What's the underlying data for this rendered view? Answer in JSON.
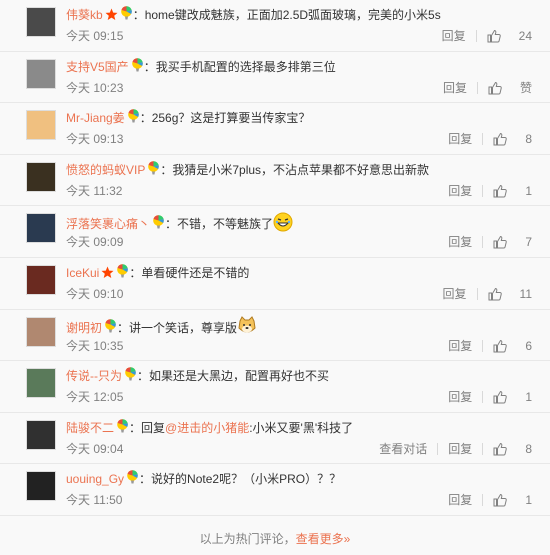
{
  "comments": [
    {
      "user": "伟葵kb",
      "text": "：home键改成魅族，正面加2.5D弧面玻璃，完美的小米5s",
      "time": "今天 09:15",
      "reply": "回复",
      "likes": "24",
      "avatar_color": "#4a4a4a"
    },
    {
      "user": "支持V5国产",
      "text": "：我买手机配置的选择最多排第三位",
      "time": "今天 10:23",
      "reply": "回复",
      "likes": "赞",
      "avatar_color": "#8a8a8a"
    },
    {
      "user": "Mr-Jiang姜",
      "text": "：256g？这是打算要当传家宝？",
      "time": "今天 09:13",
      "reply": "回复",
      "likes": "8",
      "avatar_color": "#f0c080"
    },
    {
      "user": "愤怒的蚂蚁VIP",
      "text": "：我猜是小米7plus，不沾点苹果都不好意思出新款",
      "time": "今天 11:32",
      "reply": "回复",
      "likes": "1",
      "avatar_color": "#3a3020"
    },
    {
      "user": "浮落笑裹心痛丶",
      "text": "：不错，不等魅族了",
      "time": "今天 09:09",
      "reply": "回复",
      "likes": "7",
      "avatar_color": "#2a3a50"
    },
    {
      "user": "IceKui",
      "text": "：单看硬件还是不错的",
      "time": "今天 09:10",
      "reply": "回复",
      "likes": "11",
      "avatar_color": "#6a2a20"
    },
    {
      "user": "谢明初",
      "text": "：讲一个笑话，尊享版",
      "time": "今天 10:35",
      "reply": "回复",
      "likes": "6",
      "avatar_color": "#b08870"
    },
    {
      "user": "传说--只为",
      "text": "：如果还是大黑边，配置再好也不买",
      "time": "今天 12:05",
      "reply": "回复",
      "likes": "1",
      "avatar_color": "#5a7a5a"
    },
    {
      "user": "陆骏不二",
      "text_prefix": "：回复",
      "at": "@进击的小猪能",
      "text_suffix": ":小米又要'黑'科技了",
      "time": "今天 09:04",
      "view_dialog": "查看对话",
      "reply": "回复",
      "likes": "8",
      "avatar_color": "#303030"
    },
    {
      "user": "uouing_Gy",
      "text": "：说好的Note2呢？（小米PRO）？？",
      "time": "今天 11:50",
      "reply": "回复",
      "likes": "1",
      "avatar_color": "#222222"
    }
  ],
  "footer": {
    "label": "以上为热门评论，",
    "more": "查看更多»"
  },
  "colors": {
    "username": "#eb7350",
    "meta": "#808080"
  }
}
